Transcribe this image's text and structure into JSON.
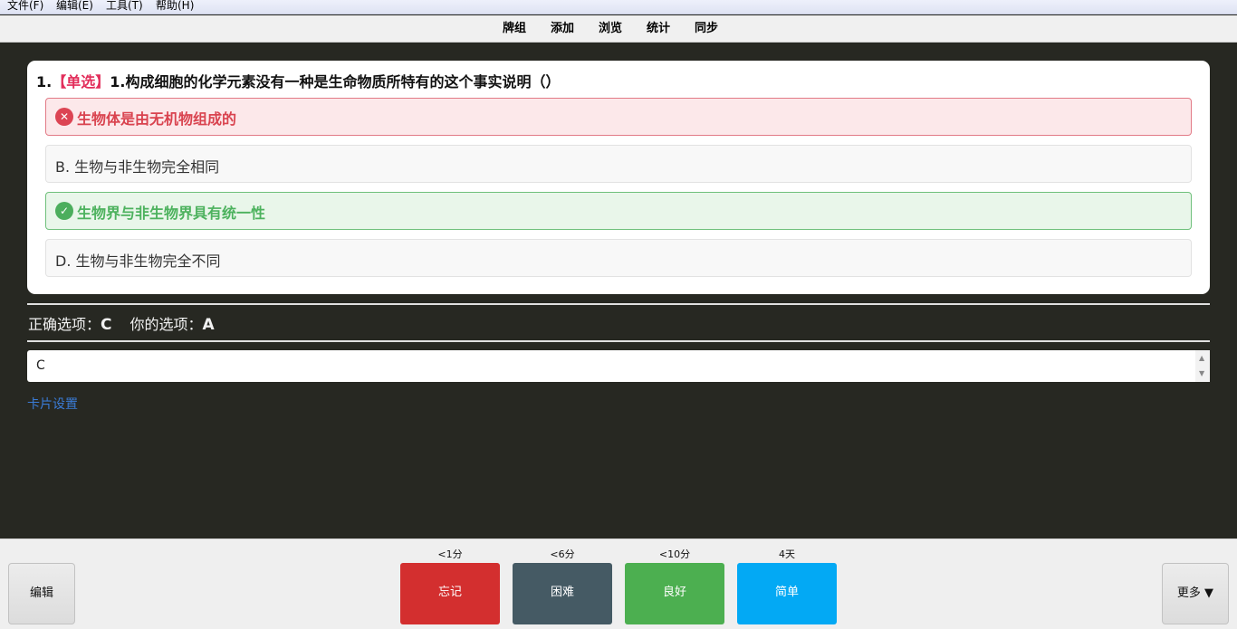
{
  "menubar": {
    "items": [
      "文件(F)",
      "编辑(E)",
      "工具(T)",
      "帮助(H)"
    ]
  },
  "toolbar": {
    "links": [
      "牌组",
      "添加",
      "浏览",
      "统计",
      "同步"
    ]
  },
  "question": {
    "number": "1.",
    "type": "【单选】",
    "text": "1.构成细胞的化学元素没有一种是生命物质所特有的这个事实说明（）"
  },
  "options": [
    {
      "text": "生物体是由无机物组成的",
      "state": "wrong",
      "icon": "x-circle-icon"
    },
    {
      "text": "B. 生物与非生物完全相同",
      "state": "normal"
    },
    {
      "text": "生物界与非生物界具有统一性",
      "state": "right",
      "icon": "check-circle-icon"
    },
    {
      "text": "D. 生物与非生物完全不同",
      "state": "normal"
    }
  ],
  "result": {
    "correct_label": "正确选项：",
    "correct_value": "C",
    "yours_label": "你的选项：",
    "yours_value": "A"
  },
  "answer_input": {
    "value": "C"
  },
  "card_settings": "卡片设置",
  "bottom": {
    "edit_label": "编辑",
    "more_label": "更多 ▼",
    "ease": [
      {
        "label": "忘记",
        "time": "<1分",
        "color": "#d32f2f"
      },
      {
        "label": "困难",
        "time": "<6分",
        "color": "#455a64"
      },
      {
        "label": "良好",
        "time": "<10分",
        "color": "#4caf50"
      },
      {
        "label": "简单",
        "time": "4天",
        "color": "#03a9f4"
      }
    ]
  }
}
